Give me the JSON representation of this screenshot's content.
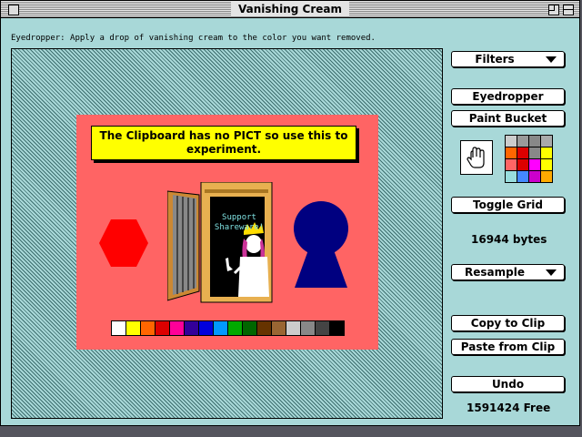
{
  "window": {
    "title": "Vanishing Cream"
  },
  "hint_text": "Eyedropper: Apply a drop of vanishing cream to the color you want removed.",
  "canvas": {
    "message": "The Clipboard has no PICT so use this to experiment.",
    "door_sign": [
      "Support",
      "Shareware!"
    ],
    "swatch_colors": [
      "#ffffff",
      "#ffff00",
      "#ff6600",
      "#dd0000",
      "#ff0099",
      "#330099",
      "#0000dd",
      "#0099ff",
      "#00aa00",
      "#006600",
      "#663300",
      "#996633",
      "#cccccc",
      "#888888",
      "#444444",
      "#000000"
    ],
    "hexagon_color": "#ff0000",
    "keyhole_color": "#000080"
  },
  "controls": {
    "filters_label": "Filters",
    "eyedropper_label": "Eyedropper",
    "paint_bucket_label": "Paint Bucket",
    "toggle_grid_label": "Toggle Grid",
    "bytes_label": "16944 bytes",
    "resample_label": "Resample",
    "copy_to_clip_label": "Copy to Clip",
    "paste_from_clip_label": "Paste from Clip",
    "undo_label": "Undo",
    "free_label": "1591424 Free"
  },
  "palette_colors": [
    "#cccccc",
    "#999999",
    "#888888",
    "#aaaaaa",
    "#ff6600",
    "#dd0000",
    "#888888",
    "#ffff00",
    "#ff6464",
    "#dd0000",
    "#ff00ff",
    "#ffff00",
    "#99dddd",
    "#4488ff",
    "#cc00cc",
    "#ffaa00"
  ],
  "colors": {
    "background": "#a8d8d8",
    "art_bg": "#ff6464",
    "message_bg": "#ffff00"
  }
}
